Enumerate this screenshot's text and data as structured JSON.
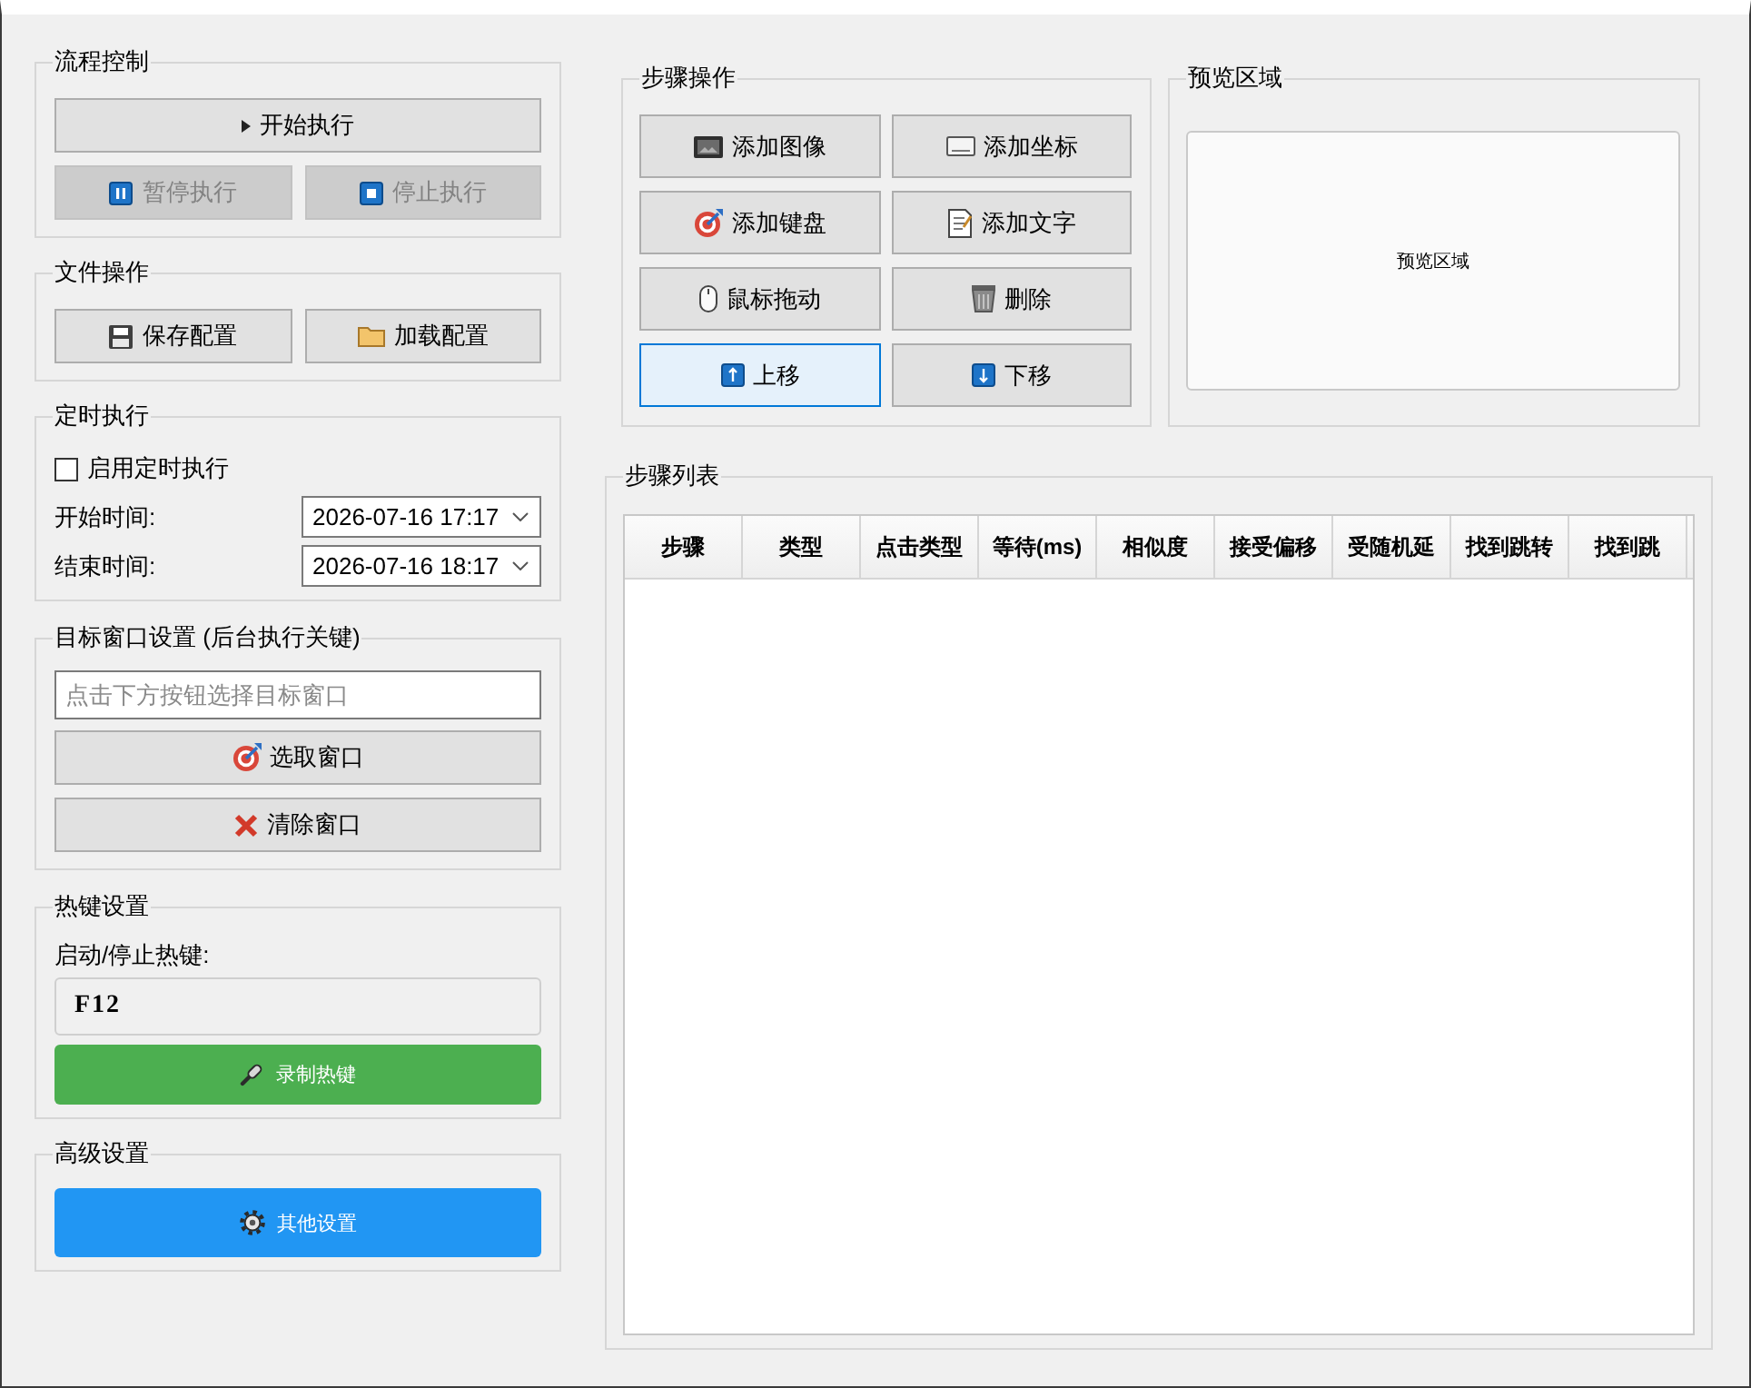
{
  "flow_control": {
    "title": "流程控制",
    "buttons": [
      {
        "label": "开始执行",
        "disabled": false
      },
      {
        "label": "暂停执行",
        "disabled": true
      },
      {
        "label": "停止执行",
        "disabled": true
      }
    ]
  },
  "file_ops": {
    "title": "文件操作",
    "buttons": [
      {
        "label": "保存配置"
      },
      {
        "label": "加载配置"
      }
    ]
  },
  "schedule": {
    "title": "定时执行",
    "enable": {
      "label": "启用定时执行",
      "checked": false
    },
    "times": [
      {
        "label": "开始时间:",
        "value": "2026-07-16 17:17"
      },
      {
        "label": "结束时间:",
        "value": "2026-07-16 18:17"
      }
    ]
  },
  "target_window": {
    "title": "目标窗口设置 (后台执行关键)",
    "field": {
      "placeholder": "点击下方按钮选择目标窗口"
    },
    "buttons": [
      {
        "label": "选取窗口"
      },
      {
        "label": "清除窗口"
      }
    ]
  },
  "hotkey": {
    "title": "热键设置",
    "label": "启动/停止热键:",
    "value": "F12",
    "button": {
      "label": "录制热键"
    }
  },
  "advanced": {
    "title": "高级设置",
    "button": {
      "label": "其他设置"
    }
  },
  "step_ops": {
    "title": "步骤操作",
    "buttons": [
      {
        "label": "添加图像",
        "focused": false
      },
      {
        "label": "添加坐标",
        "focused": false
      },
      {
        "label": "添加键盘",
        "focused": false
      },
      {
        "label": "添加文字",
        "focused": false
      },
      {
        "label": "鼠标拖动",
        "focused": false
      },
      {
        "label": "删除",
        "focused": false
      },
      {
        "label": "上移",
        "focused": true
      },
      {
        "label": "下移",
        "focused": false
      }
    ]
  },
  "preview": {
    "title": "预览区域",
    "text": "预览区域"
  },
  "step_list": {
    "title": "步骤列表",
    "table": {
      "columns": [
        "步骤",
        "类型",
        "点击类型",
        "等待(ms)",
        "相似度",
        "接受偏移",
        "受随机延",
        "找到跳转",
        "找到跳"
      ]
    }
  }
}
